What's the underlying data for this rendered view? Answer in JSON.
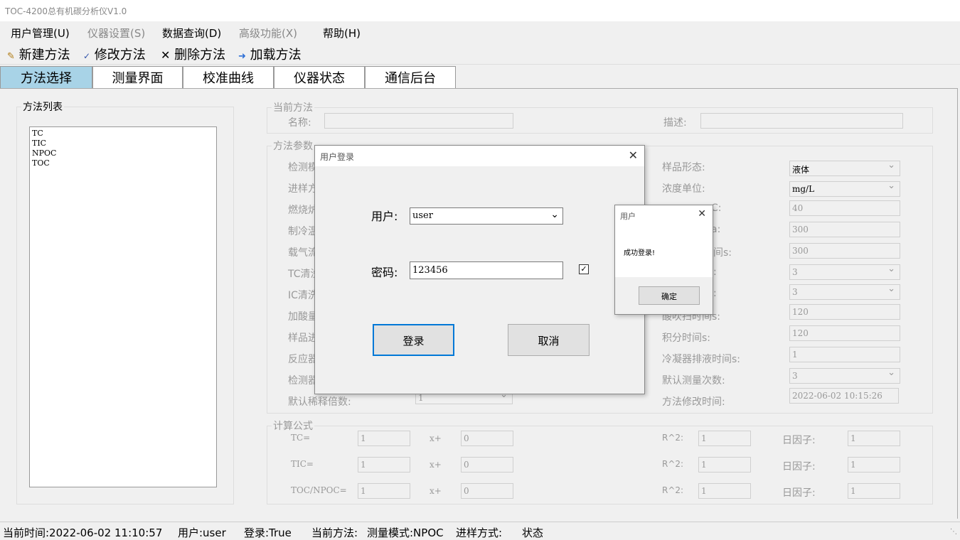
{
  "app_title": "TOC-4200总有机碳分析仪V1.0",
  "menu": [
    "用户管理(U)",
    "仪器设置(S)",
    "数据查询(D)",
    "高级功能(X)",
    "帮助(H)"
  ],
  "toolbar": {
    "new": "新建方法",
    "edit": "修改方法",
    "delete": "删除方法",
    "load": "加载方法"
  },
  "tabs": [
    "方法选择",
    "测量界面",
    "校准曲线",
    "仪器状态",
    "通信后台"
  ],
  "method_list": {
    "legend": "方法列表",
    "items": [
      "TC",
      "TIC",
      "NPOC",
      "TOC"
    ]
  },
  "current_method": {
    "legend": "当前方法",
    "name_label": "名称:",
    "desc_label": "描述:",
    "name_value": "",
    "desc_value": ""
  },
  "method_params": {
    "legend": "方法参数",
    "left_labels": [
      "检测模",
      "进样方",
      "燃烧炉",
      "制冷温",
      "载气流",
      "TC清洗",
      "IC清洗",
      "加酸量",
      "样品进",
      "反应器",
      "检测器",
      "默认稀释倍数:"
    ],
    "dilution_value": "1",
    "right": [
      {
        "label": "样品形态:",
        "value": "液体",
        "select": true
      },
      {
        "label": "浓度单位:",
        "value": "mg/L",
        "select": true
      },
      {
        "label": "C:",
        "value": "40",
        "select": false
      },
      {
        "label": "a:",
        "value": "300",
        "select": false
      },
      {
        "label": "间s:",
        "value": "300",
        "select": false
      },
      {
        "label": ":",
        "value": "3",
        "select": true
      },
      {
        "label": ":",
        "value": "3",
        "select": true
      },
      {
        "label": "酸吹扫时间s:",
        "value": "120",
        "select": false
      },
      {
        "label": "积分时间s:",
        "value": "120",
        "select": false
      },
      {
        "label": "冷凝器排液时间s:",
        "value": "1",
        "select": false
      },
      {
        "label": "默认测量次数:",
        "value": "3",
        "select": true
      },
      {
        "label": "方法修改时间:",
        "value": "2022-06-02 10:15:26",
        "select": false
      }
    ]
  },
  "formula": {
    "legend": "计算公式",
    "rows": [
      {
        "name": "TC=",
        "a": "1",
        "xplus": "x+",
        "b": "0",
        "r2": "R^2:",
        "r2v": "1",
        "f": "日因子:",
        "fv": "1"
      },
      {
        "name": "TIC=",
        "a": "1",
        "xplus": "x+",
        "b": "0",
        "r2": "R^2:",
        "r2v": "1",
        "f": "日因子:",
        "fv": "1"
      },
      {
        "name": "TOC/NPOC=",
        "a": "1",
        "xplus": "x+",
        "b": "0",
        "r2": "R^2:",
        "r2v": "1",
        "f": "日因子:",
        "fv": "1"
      }
    ]
  },
  "login_dialog": {
    "title": "用户登录",
    "user_label": "用户:",
    "user_value": "user",
    "password_label": "密码:",
    "password_value": "123456",
    "login_btn": "登录",
    "cancel_btn": "取消"
  },
  "msg_dialog": {
    "title": "用户",
    "message": "成功登录!",
    "ok_btn": "确定"
  },
  "statusbar": {
    "time": "当前时间:2022-06-02 11:10:57",
    "user": "用户:user",
    "login": "登录:True",
    "method": "当前方法:",
    "mode": "测量模式:NPOC",
    "inject": "进样方式:",
    "state": "状态"
  }
}
